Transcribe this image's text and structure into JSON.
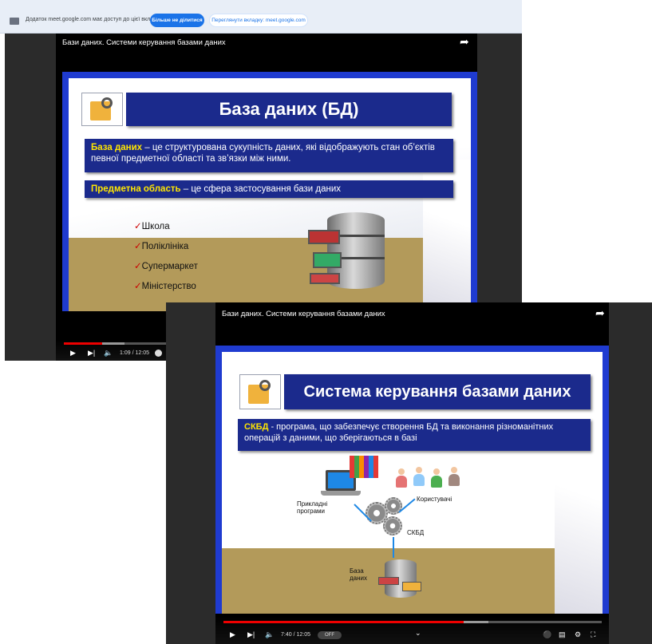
{
  "share_bar": {
    "message": "Додаток meet.google.com має доступ до цієї вкладки",
    "stop_button": "Більше не ділитися",
    "switch_button": "Переглянути вкладку: meet.google.com"
  },
  "video1": {
    "title": "Бази даних. Системи керування базами даних",
    "slide": {
      "heading": "База даних (БД)",
      "def1_term": "База даних",
      "def1_text": " – це структурована сукупність даних, які відображують стан об’єктів певної предметної області та зв’язки між ними.",
      "def2_term": "Предметна область",
      "def2_text": " – це сфера застосування бази даних",
      "checkmark": "✓",
      "list": [
        "Школа",
        "Поліклініка",
        "Супермаркет",
        "Міністерство"
      ]
    },
    "player": {
      "time": "1:09 / 12:05",
      "progress": 0.095
    }
  },
  "video2": {
    "title": "Бази даних. Системи керування базами даних",
    "slide": {
      "heading": "Система керування базами даних",
      "def_term": "СКБД",
      "def_text": " - програма, що забезпечує створення БД та виконання різноманітних операцій з даними, що зберігаються в базі",
      "label_apps": "Прикладні\nпрограми",
      "label_users": "Користувачі",
      "label_dbms": "СКБД",
      "label_db": "База\nданих"
    },
    "player": {
      "time": "7:40 / 12:05",
      "progress": 0.635,
      "subtitle_badge": "OFF"
    }
  },
  "colors": {
    "banner": "#1b2a8c",
    "slide_border": "#1f3bd0",
    "highlight": "#ffe600",
    "progress": "#e00000"
  },
  "icons": [
    "play-icon",
    "next-icon",
    "volume-icon",
    "share-arrow-icon",
    "autoplay-icon",
    "subtitles-icon",
    "settings-icon",
    "exit-fullscreen-icon",
    "chevron-down-icon"
  ]
}
